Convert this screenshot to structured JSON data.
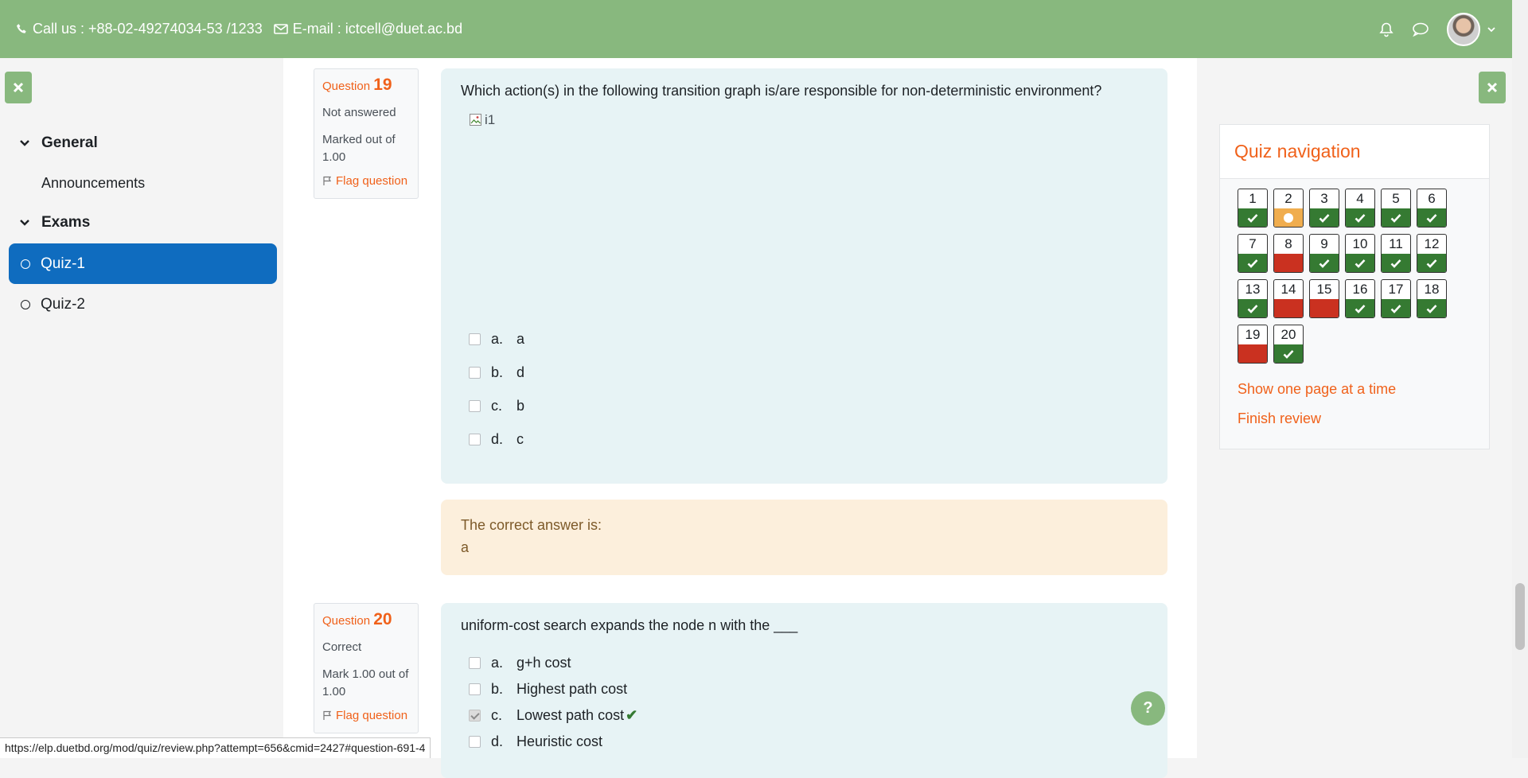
{
  "header": {
    "phone": "Call us : +88-02-49274034-53 /1233",
    "email": "E-mail : ictcell@duet.ac.bd"
  },
  "sidebar": {
    "sections": [
      {
        "label": "General",
        "items": [
          {
            "label": "Announcements"
          }
        ]
      },
      {
        "label": "Exams",
        "items": [
          {
            "label": "Quiz-1",
            "active": true
          },
          {
            "label": "Quiz-2"
          }
        ]
      }
    ]
  },
  "question19": {
    "label": "Question",
    "number": "19",
    "state": "Not answered",
    "marked": "Marked out of 1.00",
    "flag": "Flag question",
    "text": "Which action(s) in the following transition graph is/are responsible for non-deterministic environment?",
    "image_alt": "i1",
    "answers": [
      {
        "letter": "a.",
        "text": "a"
      },
      {
        "letter": "b.",
        "text": "d"
      },
      {
        "letter": "c.",
        "text": "b"
      },
      {
        "letter": "d.",
        "text": "c"
      }
    ],
    "feedback_label": "The correct answer is:",
    "feedback_value": "a"
  },
  "question20": {
    "label": "Question",
    "number": "20",
    "state": "Correct",
    "marked": "Mark 1.00 out of 1.00",
    "flag": "Flag question",
    "text": "uniform-cost search expands the node n with the ___",
    "answers": [
      {
        "letter": "a.",
        "text": "g+h cost",
        "checked": false
      },
      {
        "letter": "b.",
        "text": "Highest path cost",
        "checked": false
      },
      {
        "letter": "c.",
        "text": "Lowest path cost",
        "checked": true,
        "correct": true
      },
      {
        "letter": "d.",
        "text": "Heuristic cost",
        "checked": false
      }
    ]
  },
  "quiz_nav": {
    "title": "Quiz navigation",
    "questions": [
      {
        "n": "1",
        "status": "correct"
      },
      {
        "n": "2",
        "status": "partial"
      },
      {
        "n": "3",
        "status": "correct"
      },
      {
        "n": "4",
        "status": "correct"
      },
      {
        "n": "5",
        "status": "correct"
      },
      {
        "n": "6",
        "status": "correct"
      },
      {
        "n": "7",
        "status": "correct"
      },
      {
        "n": "8",
        "status": "wrong"
      },
      {
        "n": "9",
        "status": "correct"
      },
      {
        "n": "10",
        "status": "correct"
      },
      {
        "n": "11",
        "status": "correct"
      },
      {
        "n": "12",
        "status": "correct"
      },
      {
        "n": "13",
        "status": "correct"
      },
      {
        "n": "14",
        "status": "wrong"
      },
      {
        "n": "15",
        "status": "wrong"
      },
      {
        "n": "16",
        "status": "correct"
      },
      {
        "n": "17",
        "status": "correct"
      },
      {
        "n": "18",
        "status": "correct"
      },
      {
        "n": "19",
        "status": "wrong"
      },
      {
        "n": "20",
        "status": "correct"
      }
    ],
    "show_one_page": "Show one page at a time",
    "finish_review": "Finish review"
  },
  "help_label": "?",
  "status_url": "https://elp.duetbd.org/mod/quiz/review.php?attempt=656&cmid=2427#question-691-4",
  "colors": {
    "header_green": "#88b87e",
    "accent_orange": "#f0611a",
    "active_blue": "#0f6cbf",
    "correct_green": "#357a32",
    "wrong_red": "#ca3120",
    "partial_orange": "#f0ad4e"
  }
}
